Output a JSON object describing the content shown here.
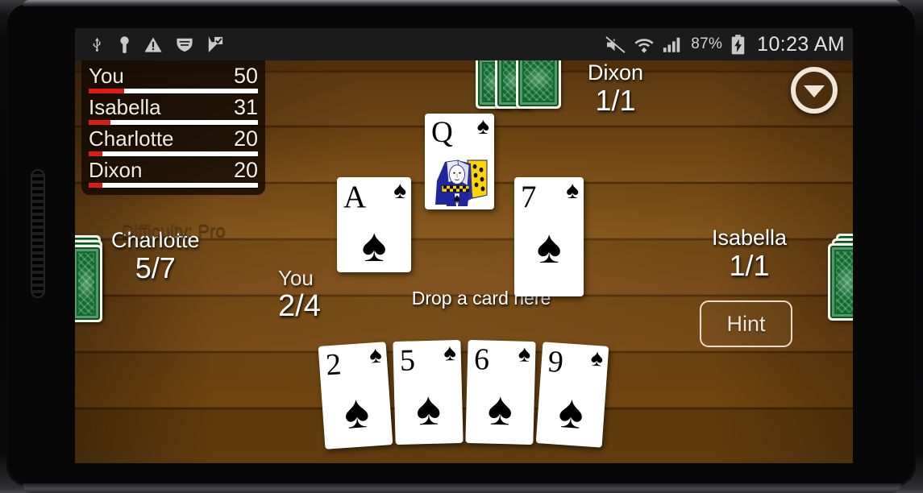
{
  "status_bar": {
    "left_icons": [
      "usb-icon",
      "key-icon",
      "warning-icon",
      "vpn-shield-icon",
      "flag-check-icon"
    ],
    "mute_icon": "volume-muted-icon",
    "wifi_icon": "wifi-icon",
    "signal_icon": "cellular-signal-icon",
    "battery_percent": "87%",
    "battery_icon": "battery-charging-icon",
    "clock": "10:23 AM"
  },
  "scoreboard": {
    "rows": [
      {
        "name": "You",
        "score": "50",
        "bar_percent": 21
      },
      {
        "name": "Isabella",
        "score": "31",
        "bar_percent": 13
      },
      {
        "name": "Charlotte",
        "score": "20",
        "bar_percent": 8
      },
      {
        "name": "Dixon",
        "score": "20",
        "bar_percent": 8
      }
    ],
    "difficulty": "Difficulty: Pro"
  },
  "players": {
    "dixon": {
      "name": "Dixon",
      "count": "1/1",
      "cards_in_hand": 3
    },
    "charlotte": {
      "name": "Charlotte",
      "count": "5/7",
      "cards_in_hand": 3
    },
    "isabella": {
      "name": "Isabella",
      "count": "1/1",
      "cards_in_hand": 3
    },
    "you": {
      "name": "You",
      "count": "2/4"
    }
  },
  "table": {
    "drop_hint": "Drop a card here",
    "played_cards": [
      {
        "rank": "A",
        "suit": "♠",
        "position": "left",
        "type": "pip"
      },
      {
        "rank": "Q",
        "suit": "♠",
        "position": "center",
        "type": "face"
      },
      {
        "rank": "7",
        "suit": "♠",
        "position": "right",
        "type": "pip"
      }
    ]
  },
  "hand": {
    "cards": [
      {
        "rank": "2",
        "suit": "♠"
      },
      {
        "rank": "5",
        "suit": "♠"
      },
      {
        "rank": "6",
        "suit": "♠"
      },
      {
        "rank": "9",
        "suit": "♠"
      }
    ]
  },
  "controls": {
    "hint_label": "Hint",
    "expand_icon": "chevron-down-circle-icon"
  },
  "colors": {
    "bar_fill": "#e01b12",
    "bar_track": "#ffffff",
    "card_back": "#0f6b2c",
    "table_wood": "#6b4415",
    "status_bar_bg": "#1b1b1b",
    "accent_text": "#f0e7d8"
  }
}
